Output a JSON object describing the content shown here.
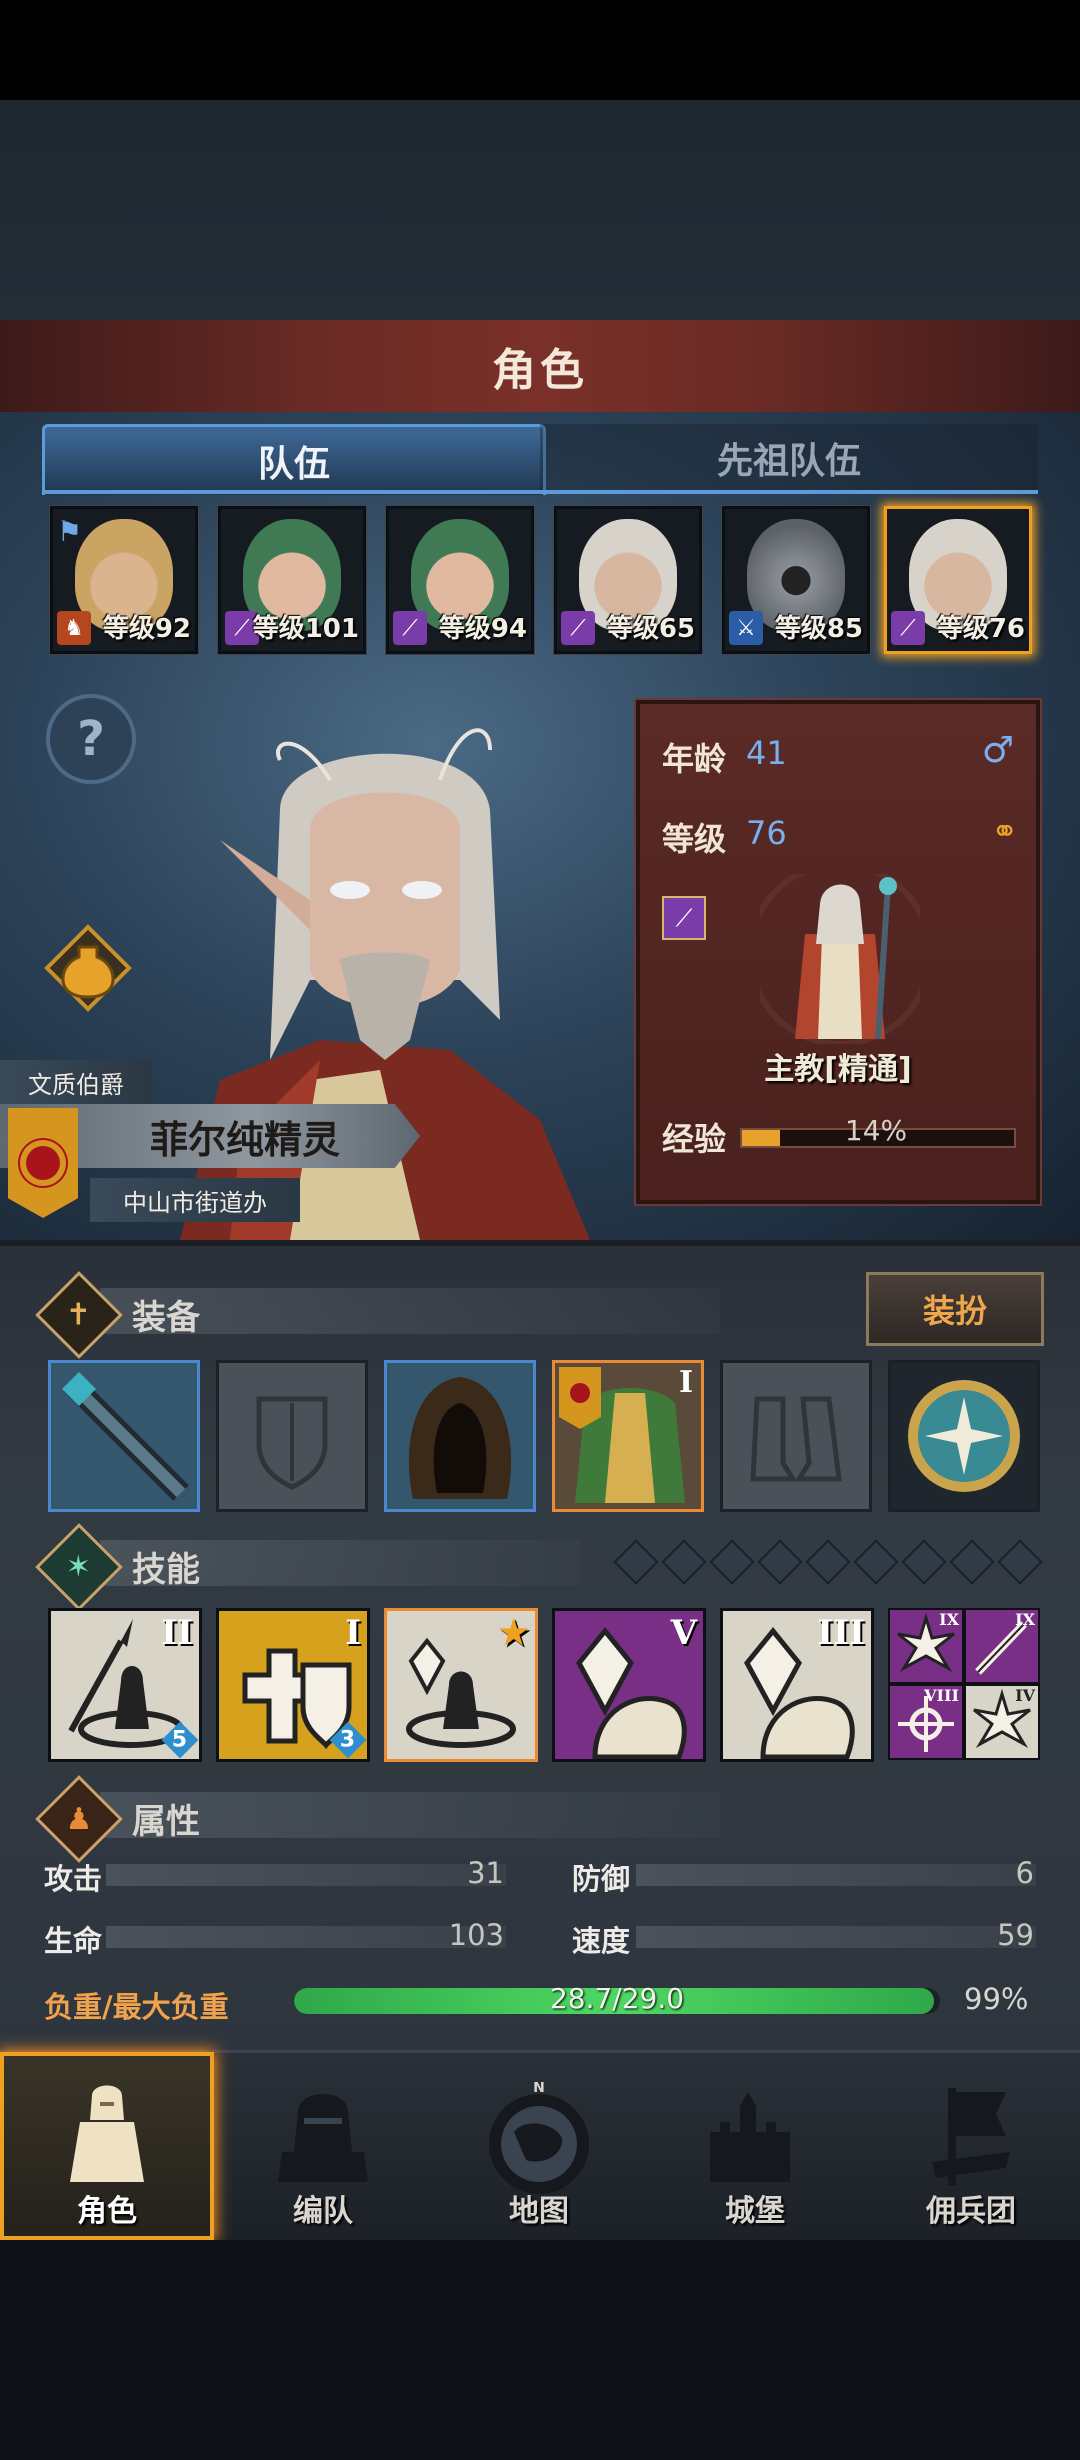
{
  "header": {
    "title": "角色"
  },
  "tabs": [
    {
      "label": "队伍",
      "active": true
    },
    {
      "label": "先祖队伍",
      "active": false
    }
  ],
  "roster": [
    {
      "level_text": "等级92",
      "class_color": "#b5471e",
      "class_icon": "horse-icon",
      "hair": "#c9a463",
      "flag": true
    },
    {
      "level_text": "等级101",
      "class_color": "#7a3ca8",
      "class_icon": "staff-icon",
      "hair": "#3f7a55"
    },
    {
      "level_text": "等级94",
      "class_color": "#7a3ca8",
      "class_icon": "staff-icon",
      "hair": "#3f7a55"
    },
    {
      "level_text": "等级65",
      "class_color": "#7a3ca8",
      "class_icon": "staff-icon",
      "hair": "#d7d3cb"
    },
    {
      "level_text": "等级85",
      "class_color": "#2a5ca8",
      "class_icon": "sword-icon",
      "hair": "#6a6f75"
    },
    {
      "level_text": "等级76",
      "class_color": "#7a3ca8",
      "class_icon": "staff-icon",
      "hair": "#d7d3cb",
      "selected": true
    }
  ],
  "character": {
    "title_rank": "文质伯爵",
    "name": "菲尔纯精灵",
    "location": "中山市街道办",
    "age_label": "年龄",
    "age": "41",
    "level_label": "等级",
    "level": "76",
    "job": "主教[精通]",
    "exp_label": "经验",
    "exp_text": "14%",
    "exp_fraction": 0.14
  },
  "equipment": {
    "section_title": "装备",
    "dress_button": "装扮",
    "slots": [
      {
        "name": "staff",
        "state": "blue"
      },
      {
        "name": "shield",
        "state": "empty"
      },
      {
        "name": "hood",
        "state": "blue"
      },
      {
        "name": "armor",
        "state": "orange",
        "rank": "I"
      },
      {
        "name": "boots",
        "state": "empty"
      },
      {
        "name": "amulet",
        "state": "filled"
      }
    ]
  },
  "skills": {
    "section_title": "技能",
    "gem_count": 9,
    "items": [
      {
        "rank": "II",
        "count": "5",
        "bg": "#d8d4c8"
      },
      {
        "rank": "I",
        "count": "3",
        "bg": "#d6a21e"
      },
      {
        "rank": "",
        "star": "★",
        "bg": "#d8d4c8",
        "highlight": true
      },
      {
        "rank": "V",
        "bg": "#7a2f86"
      },
      {
        "rank": "III",
        "bg": "#d8d4c8"
      }
    ],
    "minis": [
      {
        "rank": "IX",
        "bg": "#7a2f86"
      },
      {
        "rank": "IX",
        "bg": "#7a2f86"
      },
      {
        "rank": "VIII",
        "bg": "#7a2f86"
      },
      {
        "rank": "IV",
        "bg": "#d8d4c8"
      }
    ]
  },
  "attributes": {
    "section_title": "属性",
    "attack_label": "攻击",
    "attack": "31",
    "defense_label": "防御",
    "defense": "6",
    "hp_label": "生命",
    "hp": "103",
    "speed_label": "速度",
    "speed": "59",
    "load_label": "负重/最大负重",
    "load_text": "28.7/29.0",
    "load_pct": "99%",
    "load_fraction": 0.99
  },
  "nav": [
    {
      "label": "角色",
      "active": true
    },
    {
      "label": "编队"
    },
    {
      "label": "地图"
    },
    {
      "label": "城堡"
    },
    {
      "label": "佣兵团"
    }
  ],
  "map_compass": "N"
}
